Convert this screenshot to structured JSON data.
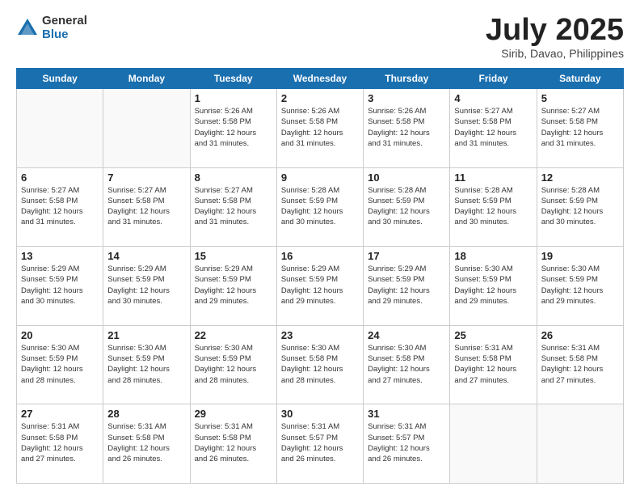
{
  "header": {
    "logo_general": "General",
    "logo_blue": "Blue",
    "month_title": "July 2025",
    "location": "Sirib, Davao, Philippines"
  },
  "days_of_week": [
    "Sunday",
    "Monday",
    "Tuesday",
    "Wednesday",
    "Thursday",
    "Friday",
    "Saturday"
  ],
  "weeks": [
    [
      {
        "day": "",
        "content": ""
      },
      {
        "day": "",
        "content": ""
      },
      {
        "day": "1",
        "content": "Sunrise: 5:26 AM\nSunset: 5:58 PM\nDaylight: 12 hours\nand 31 minutes."
      },
      {
        "day": "2",
        "content": "Sunrise: 5:26 AM\nSunset: 5:58 PM\nDaylight: 12 hours\nand 31 minutes."
      },
      {
        "day": "3",
        "content": "Sunrise: 5:26 AM\nSunset: 5:58 PM\nDaylight: 12 hours\nand 31 minutes."
      },
      {
        "day": "4",
        "content": "Sunrise: 5:27 AM\nSunset: 5:58 PM\nDaylight: 12 hours\nand 31 minutes."
      },
      {
        "day": "5",
        "content": "Sunrise: 5:27 AM\nSunset: 5:58 PM\nDaylight: 12 hours\nand 31 minutes."
      }
    ],
    [
      {
        "day": "6",
        "content": "Sunrise: 5:27 AM\nSunset: 5:58 PM\nDaylight: 12 hours\nand 31 minutes."
      },
      {
        "day": "7",
        "content": "Sunrise: 5:27 AM\nSunset: 5:58 PM\nDaylight: 12 hours\nand 31 minutes."
      },
      {
        "day": "8",
        "content": "Sunrise: 5:27 AM\nSunset: 5:58 PM\nDaylight: 12 hours\nand 31 minutes."
      },
      {
        "day": "9",
        "content": "Sunrise: 5:28 AM\nSunset: 5:59 PM\nDaylight: 12 hours\nand 30 minutes."
      },
      {
        "day": "10",
        "content": "Sunrise: 5:28 AM\nSunset: 5:59 PM\nDaylight: 12 hours\nand 30 minutes."
      },
      {
        "day": "11",
        "content": "Sunrise: 5:28 AM\nSunset: 5:59 PM\nDaylight: 12 hours\nand 30 minutes."
      },
      {
        "day": "12",
        "content": "Sunrise: 5:28 AM\nSunset: 5:59 PM\nDaylight: 12 hours\nand 30 minutes."
      }
    ],
    [
      {
        "day": "13",
        "content": "Sunrise: 5:29 AM\nSunset: 5:59 PM\nDaylight: 12 hours\nand 30 minutes."
      },
      {
        "day": "14",
        "content": "Sunrise: 5:29 AM\nSunset: 5:59 PM\nDaylight: 12 hours\nand 30 minutes."
      },
      {
        "day": "15",
        "content": "Sunrise: 5:29 AM\nSunset: 5:59 PM\nDaylight: 12 hours\nand 29 minutes."
      },
      {
        "day": "16",
        "content": "Sunrise: 5:29 AM\nSunset: 5:59 PM\nDaylight: 12 hours\nand 29 minutes."
      },
      {
        "day": "17",
        "content": "Sunrise: 5:29 AM\nSunset: 5:59 PM\nDaylight: 12 hours\nand 29 minutes."
      },
      {
        "day": "18",
        "content": "Sunrise: 5:30 AM\nSunset: 5:59 PM\nDaylight: 12 hours\nand 29 minutes."
      },
      {
        "day": "19",
        "content": "Sunrise: 5:30 AM\nSunset: 5:59 PM\nDaylight: 12 hours\nand 29 minutes."
      }
    ],
    [
      {
        "day": "20",
        "content": "Sunrise: 5:30 AM\nSunset: 5:59 PM\nDaylight: 12 hours\nand 28 minutes."
      },
      {
        "day": "21",
        "content": "Sunrise: 5:30 AM\nSunset: 5:59 PM\nDaylight: 12 hours\nand 28 minutes."
      },
      {
        "day": "22",
        "content": "Sunrise: 5:30 AM\nSunset: 5:59 PM\nDaylight: 12 hours\nand 28 minutes."
      },
      {
        "day": "23",
        "content": "Sunrise: 5:30 AM\nSunset: 5:58 PM\nDaylight: 12 hours\nand 28 minutes."
      },
      {
        "day": "24",
        "content": "Sunrise: 5:30 AM\nSunset: 5:58 PM\nDaylight: 12 hours\nand 27 minutes."
      },
      {
        "day": "25",
        "content": "Sunrise: 5:31 AM\nSunset: 5:58 PM\nDaylight: 12 hours\nand 27 minutes."
      },
      {
        "day": "26",
        "content": "Sunrise: 5:31 AM\nSunset: 5:58 PM\nDaylight: 12 hours\nand 27 minutes."
      }
    ],
    [
      {
        "day": "27",
        "content": "Sunrise: 5:31 AM\nSunset: 5:58 PM\nDaylight: 12 hours\nand 27 minutes."
      },
      {
        "day": "28",
        "content": "Sunrise: 5:31 AM\nSunset: 5:58 PM\nDaylight: 12 hours\nand 26 minutes."
      },
      {
        "day": "29",
        "content": "Sunrise: 5:31 AM\nSunset: 5:58 PM\nDaylight: 12 hours\nand 26 minutes."
      },
      {
        "day": "30",
        "content": "Sunrise: 5:31 AM\nSunset: 5:57 PM\nDaylight: 12 hours\nand 26 minutes."
      },
      {
        "day": "31",
        "content": "Sunrise: 5:31 AM\nSunset: 5:57 PM\nDaylight: 12 hours\nand 26 minutes."
      },
      {
        "day": "",
        "content": ""
      },
      {
        "day": "",
        "content": ""
      }
    ]
  ]
}
